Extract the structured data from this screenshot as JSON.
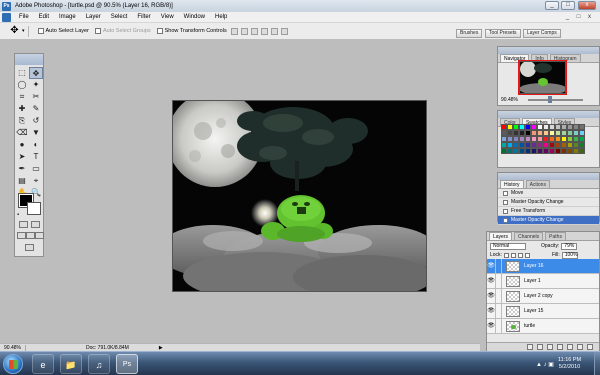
{
  "window": {
    "title": "Adobe Photoshop - [turtle.psd @ 90.5% (Layer 16, RGB/8)]",
    "logo": "Ps",
    "controls": {
      "minimize": "_",
      "maximize": "□",
      "close": "x"
    }
  },
  "menu": {
    "items": [
      "File",
      "Edit",
      "Image",
      "Layer",
      "Select",
      "Filter",
      "View",
      "Window",
      "Help"
    ],
    "mdi_controls": {
      "minimize": "_",
      "restore": "□",
      "close": "x"
    }
  },
  "options_bar": {
    "auto_select_layer": "Auto Select Layer",
    "auto_select_groups": "Auto Select Groups",
    "show_transform_controls": "Show Transform Controls"
  },
  "palette_well": {
    "tabs": [
      "Brushes",
      "Tool Presets",
      "Layer Comps"
    ]
  },
  "toolbox": {
    "tools": [
      "marquee-tool",
      "move-tool",
      "lasso-tool",
      "magic-wand-tool",
      "crop-tool",
      "slice-tool",
      "healing-brush-tool",
      "brush-tool",
      "clone-stamp-tool",
      "history-brush-tool",
      "eraser-tool",
      "paint-bucket-tool",
      "blur-tool",
      "dodge-tool",
      "path-selection-tool",
      "type-tool",
      "pen-tool",
      "shape-tool",
      "notes-tool",
      "eyedropper-tool",
      "hand-tool",
      "zoom-tool"
    ],
    "tool_glyphs": [
      "⬚",
      "✥",
      "◯",
      "✦",
      "⌗",
      "✂",
      "✚",
      "✎",
      "⎘",
      "↺",
      "⌫",
      "▼",
      "●",
      "◐",
      "➤",
      "T",
      "✒",
      "▭",
      "▤",
      "⌖",
      "✋",
      "🔍"
    ],
    "active_tool_index": 1,
    "foreground_color": "#000000",
    "background_color": "#ffffff"
  },
  "status": {
    "zoom": "90.48%",
    "doc_info": "Doc: 791.0K/8.84M",
    "arrow": "▶"
  },
  "navigator": {
    "tabs": [
      "Navigator",
      "Info",
      "Histogram"
    ],
    "zoom": "90.48%",
    "view_box_color": "#e01818"
  },
  "swatches_panel": {
    "tabs": [
      "Color",
      "Swatches",
      "Styles"
    ],
    "colors": [
      "#ff0000",
      "#ffff00",
      "#00ff00",
      "#00ffff",
      "#0000ff",
      "#ff00ff",
      "#ffffff",
      "#ebebeb",
      "#d7d7d7",
      "#c2c2c2",
      "#adadad",
      "#999999",
      "#858585",
      "#707070",
      "#5c5c5c",
      "#474747",
      "#333333",
      "#1f1f1f",
      "#000000",
      "#f7977a",
      "#f9ad81",
      "#fdc68a",
      "#fff79a",
      "#c4df9b",
      "#a2d39c",
      "#82ca9d",
      "#7bcdc8",
      "#6ecff6",
      "#7ea7d8",
      "#8493ca",
      "#8882be",
      "#a187be",
      "#bc8dbf",
      "#f49ac2",
      "#f6989d",
      "#ed1c24",
      "#f26522",
      "#f7941d",
      "#fff200",
      "#8dc63f",
      "#39b54a",
      "#00a651",
      "#00a99d",
      "#00aeef",
      "#0072bc",
      "#0054a6",
      "#2e3192",
      "#662d91",
      "#92278f",
      "#ec008c",
      "#9e0b0f",
      "#a0410d",
      "#a36209",
      "#aba000",
      "#598527",
      "#1a7b30",
      "#007236",
      "#00746b",
      "#0076a3",
      "#004b80",
      "#003471",
      "#1b1464",
      "#440e62",
      "#630460",
      "#9e005d",
      "#790000",
      "#7b2e00",
      "#7d4900",
      "#827b00",
      "#406618"
    ]
  },
  "history_panel": {
    "tabs": [
      "History",
      "Actions"
    ],
    "items": [
      "Move",
      "Master Opacity Change",
      "Free Transform",
      "Master Opacity Change"
    ],
    "selected_index": 3
  },
  "layers_panel": {
    "tabs": [
      "Layers",
      "Channels",
      "Paths"
    ],
    "blend_mode": "Normal",
    "opacity_label": "Opacity:",
    "opacity": "79%",
    "lock_label": "Lock:",
    "fill_label": "Fill:",
    "fill": "100%",
    "eye_glyph": "👁",
    "layers": [
      {
        "name": "Layer 16",
        "selected": true,
        "has_art": false
      },
      {
        "name": "Layer 1",
        "selected": false,
        "has_art": false
      },
      {
        "name": "Layer 2 copy",
        "selected": false,
        "has_art": false
      },
      {
        "name": "Layer 15",
        "selected": false,
        "has_art": false
      },
      {
        "name": "turtle",
        "selected": false,
        "has_art": true
      }
    ]
  },
  "taskbar": {
    "apps": [
      {
        "name": "ie",
        "glyph": "e"
      },
      {
        "name": "explorer",
        "glyph": "📁"
      },
      {
        "name": "itunes",
        "glyph": "♫"
      },
      {
        "name": "photoshop",
        "glyph": "Ps"
      }
    ],
    "tray_glyphs": "▲ ♪ ▣",
    "time": "11:16 PM",
    "date": "5/2/2010"
  }
}
